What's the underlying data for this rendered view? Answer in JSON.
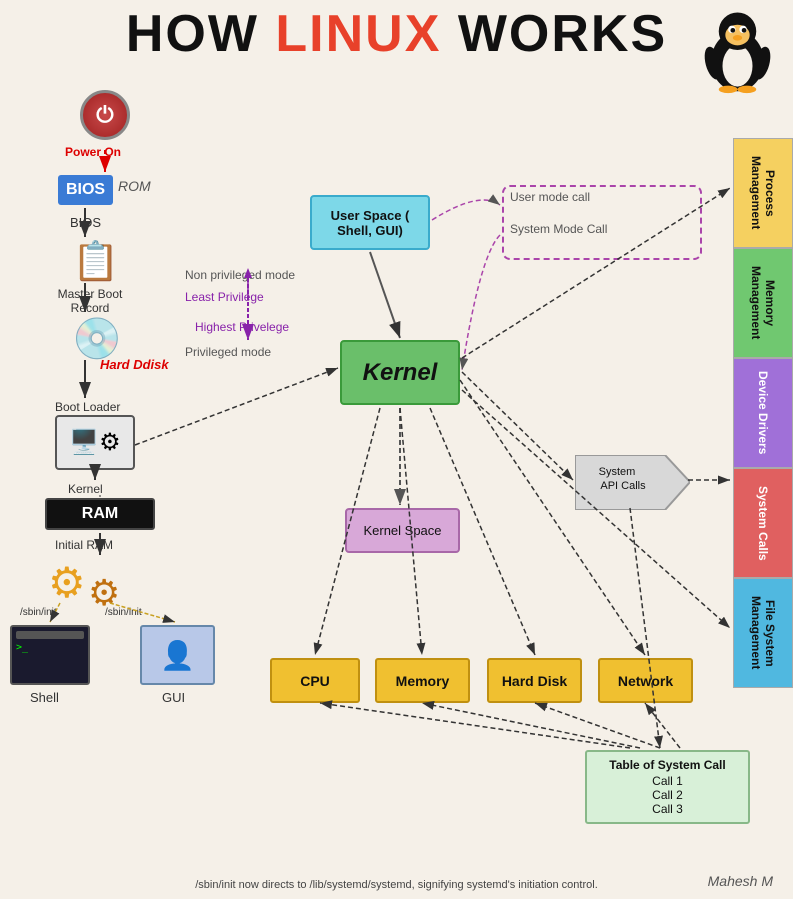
{
  "title": {
    "prefix": "HOW ",
    "highlight": "LINUX",
    "suffix": " WORKS"
  },
  "left_column": {
    "power_on": "Power On",
    "bios": "BIOS",
    "rom": "ROM",
    "bios_label": "BIOS",
    "mbr": "Master Boot\nRecord",
    "hdd": "Hard Ddisk",
    "bootloader": "Boot Loader",
    "kernel": "Kernel",
    "initial_ram": "Initial RAM",
    "sbin_init_left": "/sbin/init",
    "sbin_init_right": "/sbin/init",
    "shell": "Shell",
    "gui": "GUI",
    "ram": "RAM"
  },
  "center": {
    "user_space": "User Space (\nShell, GUI)",
    "kernel": "Kernel",
    "kernel_space": "Kernel Space",
    "non_privileged": "Non privileged mode",
    "least_privilege": "Least Privilege",
    "highest_privilege": "Highest Privelege",
    "privileged_mode": "Privileged mode",
    "user_mode_call": "User mode call",
    "system_mode_call": "System Mode Call",
    "api_calls": "System\nAPI Calls"
  },
  "resources": {
    "cpu": "CPU",
    "memory": "Memory",
    "hard_disk": "Hard Disk",
    "network": "Network"
  },
  "syscall_table": {
    "title": "Table of System Call",
    "call1": "Call 1",
    "call2": "Call 2",
    "call3": "Call 3"
  },
  "sidebar": {
    "process_mgmt": "Process Management",
    "memory_mgmt": "Memory Management",
    "device_drivers": "Device Drivers",
    "system_calls": "System Calls",
    "filesystem_mgmt": "File System Management"
  },
  "footer": {
    "note": "/sbin/init now directs to /lib/systemd/systemd, signifying systemd's initiation control.",
    "author": "Mahesh M"
  }
}
